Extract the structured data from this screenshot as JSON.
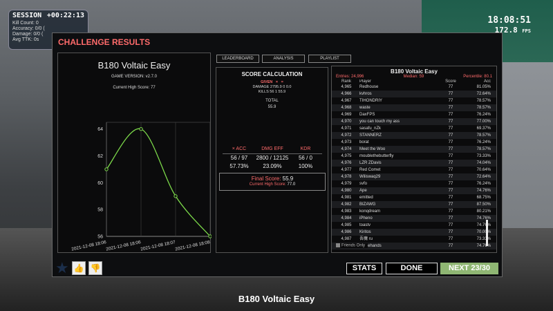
{
  "session": {
    "title": "SESSION",
    "timer": "+00:22:13",
    "rows": [
      "Kill Count: 0",
      "Accuracy: 0/0 (",
      "Damage: 0/0 (",
      "Avg TTK: 0s"
    ]
  },
  "clock": {
    "time": "18:08:51",
    "fps": "172.8",
    "fps_unit": "FPS"
  },
  "panel": {
    "title": "CHALLENGE RESULTS"
  },
  "chart_panel": {
    "title": "B180 Voltaic Easy",
    "version": "GAME VERSION: v2.7.0",
    "high_score": "Current High Score: 77"
  },
  "chart_data": {
    "type": "line",
    "x": [
      "2021-12-08 18:06",
      "2021-12-08 18:06",
      "2021-12-08 18:07",
      "2021-12-08 18:08"
    ],
    "series": [
      {
        "values": [
          61,
          64,
          59,
          56
        ]
      }
    ],
    "ytick_labels": [
      "56",
      "58",
      "60",
      "62",
      "64"
    ],
    "ylim": [
      56,
      64.5
    ],
    "line_color": "#7cd94a"
  },
  "tabs": [
    "LEADERBOARD",
    "ANALYSIS",
    "PLAYLIST"
  ],
  "score_calc": {
    "title": "SCORE CALCULATION",
    "given_label": "GIVEN",
    "op1": "×",
    "op2": "=",
    "damage_line": "DAMAGE 2795.9 0 0.0",
    "kills_line": "KILLS 56 1 55.9",
    "total_label": "TOTAL",
    "total_value": "55.9",
    "stats": [
      {
        "label": "× ACC",
        "v1": "56 / 97",
        "v2": "57.73%"
      },
      {
        "label": "DMG EFF",
        "v1": "2800 / 12125",
        "v2": "23.09%"
      },
      {
        "label": "KDR",
        "v1": "56 / 0",
        "v2": "100%"
      }
    ],
    "final_label": "Final Score:",
    "final_value": "55.9",
    "hs_label": "Current High Score:",
    "hs_value": "77.0"
  },
  "leaderboard": {
    "title": "B180 Voltaic Easy",
    "entries": "Entries: 24,996",
    "median": "Median: 59",
    "percentile": "Percentile: 80.1",
    "columns": [
      "Rank",
      "Player",
      "Score",
      "Acc"
    ],
    "rows": [
      [
        "4,965",
        "Redhouse",
        "77",
        "81.05%"
      ],
      [
        "4,966",
        "kvhros",
        "77",
        "72.64%"
      ],
      [
        "4,967",
        "TIHONDRIY",
        "77",
        "78.57%"
      ],
      [
        "4,968",
        "waste",
        "77",
        "78.57%"
      ],
      [
        "4,969",
        "DaxFPS",
        "77",
        "76.24%"
      ],
      [
        "4,970",
        "you can touch my ass",
        "77",
        "77.00%"
      ],
      [
        "4,971",
        "sasafu_nZk",
        "77",
        "69.37%"
      ],
      [
        "4,972",
        "STANNERZ",
        "77",
        "78.57%"
      ],
      [
        "4,973",
        "borat",
        "77",
        "76.24%"
      ],
      [
        "4,974",
        "Meet the Woo",
        "77",
        "78.57%"
      ],
      [
        "4,975",
        "moublethebutterfly",
        "77",
        "73.33%"
      ],
      [
        "4,976",
        "LZR ZDavis",
        "77",
        "74.04%"
      ],
      [
        "4,977",
        "Red Comet",
        "77",
        "70.64%"
      ],
      [
        "4,978",
        "Wiliswaq29",
        "77",
        "72.64%"
      ],
      [
        "4,979",
        "svfo",
        "77",
        "76.24%"
      ],
      [
        "4,980",
        "Ape",
        "77",
        "74.76%"
      ],
      [
        "4,981",
        "emitted",
        "77",
        "68.75%"
      ],
      [
        "4,982",
        "BIZAWG",
        "77",
        "87.50%"
      ],
      [
        "4,983",
        "konqdream",
        "77",
        "80.21%"
      ],
      [
        "4,984",
        "iPheno",
        "77",
        "74.76%"
      ],
      [
        "4,985",
        "toastv",
        "77",
        "74.76%"
      ],
      [
        "4,986",
        "Kiritos",
        "77",
        "70.00%"
      ],
      [
        "4,987",
        "吾魔 ru",
        "77",
        "73.33%"
      ],
      [
        "4,988",
        "Anglehands",
        "77",
        "74.76%"
      ]
    ],
    "friends_only": "Friends Only"
  },
  "buttons": {
    "stats": "STATS",
    "done": "DONE",
    "next": "NEXT 23/30"
  },
  "icons": {
    "star": "star-icon",
    "like": "thumbs-up-icon",
    "dislike": "thumbs-down-icon"
  },
  "caption": "B180 Voltaic Easy"
}
